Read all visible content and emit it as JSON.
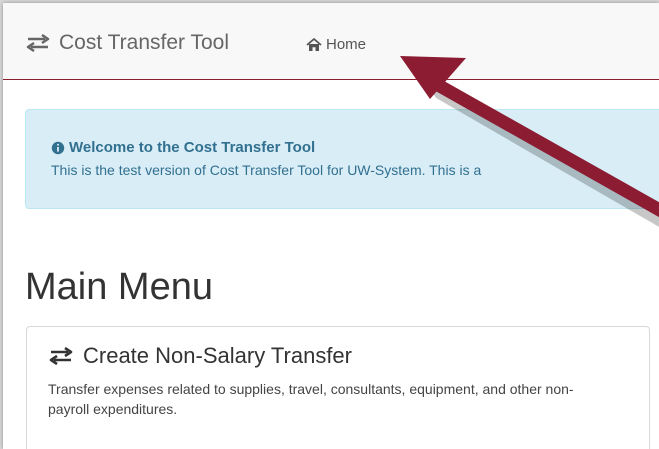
{
  "navbar": {
    "brand": "Cost Transfer Tool",
    "brand_icon": "exchange-icon",
    "home_label": "Home",
    "home_icon": "home-icon",
    "border_color": "#8a1f2f"
  },
  "alert": {
    "title": "Welcome to the Cost Transfer Tool",
    "body": "This is the test version of Cost Transfer Tool for UW-System. This is a",
    "icon": "info-circle-icon",
    "background": "#d9edf7",
    "text_color": "#31708f"
  },
  "main": {
    "title": "Main Menu",
    "cards": [
      {
        "title": "Create Non-Salary Transfer",
        "icon": "exchange-icon",
        "description": "Transfer expenses related to supplies, travel, consultants, equipment, and other non-payroll expenditures."
      }
    ]
  },
  "annotation": {
    "arrow_color": "#8b1c32",
    "target": "Home"
  }
}
